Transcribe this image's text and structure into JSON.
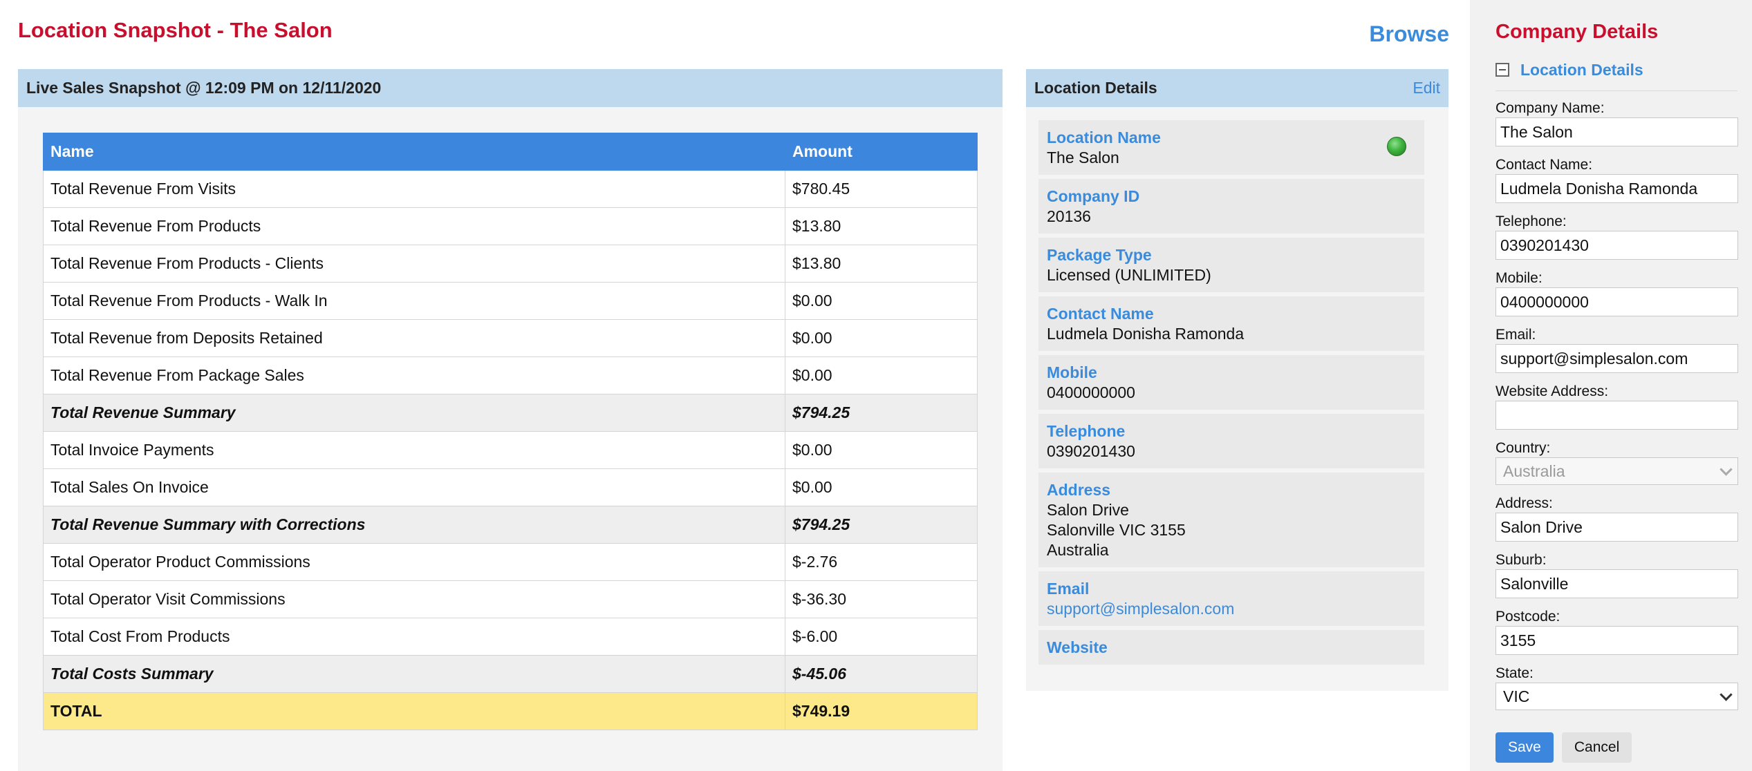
{
  "header": {
    "title": "Location Snapshot - The Salon",
    "browse_label": "Browse"
  },
  "snapshot": {
    "header": "Live Sales Snapshot @ 12:09 PM on 12/11/2020",
    "columns": [
      "Name",
      "Amount"
    ],
    "rows": [
      {
        "name": "Total Revenue From Visits",
        "amount": "$780.45",
        "style": "normal"
      },
      {
        "name": "Total Revenue From Products",
        "amount": "$13.80",
        "style": "normal"
      },
      {
        "name": "Total Revenue From Products - Clients",
        "amount": "$13.80",
        "style": "normal"
      },
      {
        "name": "Total Revenue From Products - Walk In",
        "amount": "$0.00",
        "style": "normal"
      },
      {
        "name": "Total Revenue from Deposits Retained",
        "amount": "$0.00",
        "style": "normal"
      },
      {
        "name": "Total Revenue From Package Sales",
        "amount": "$0.00",
        "style": "normal"
      },
      {
        "name": "Total Revenue Summary",
        "amount": "$794.25",
        "style": "summary"
      },
      {
        "name": "Total Invoice Payments",
        "amount": "$0.00",
        "style": "normal"
      },
      {
        "name": "Total Sales On Invoice",
        "amount": "$0.00",
        "style": "normal"
      },
      {
        "name": "Total Revenue Summary with Corrections",
        "amount": "$794.25",
        "style": "summary"
      },
      {
        "name": "Total Operator Product Commissions",
        "amount": "$-2.76",
        "style": "normal"
      },
      {
        "name": "Total Operator Visit Commissions",
        "amount": "$-36.30",
        "style": "normal"
      },
      {
        "name": "Total Cost From Products",
        "amount": "$-6.00",
        "style": "normal"
      },
      {
        "name": "Total Costs Summary",
        "amount": "$-45.06",
        "style": "summary"
      },
      {
        "name": "TOTAL",
        "amount": "$749.19",
        "style": "total"
      }
    ]
  },
  "location": {
    "header": "Location Details",
    "edit_label": "Edit",
    "items": [
      {
        "label": "Location Name",
        "lines": [
          "The Salon"
        ],
        "status_icon": "green-status-icon"
      },
      {
        "label": "Company ID",
        "lines": [
          "20136"
        ]
      },
      {
        "label": "Package Type",
        "lines": [
          "Licensed (UNLIMITED)"
        ]
      },
      {
        "label": "Contact Name",
        "lines": [
          "Ludmela Donisha Ramonda"
        ]
      },
      {
        "label": "Mobile",
        "lines": [
          "0400000000"
        ]
      },
      {
        "label": "Telephone",
        "lines": [
          "0390201430"
        ]
      },
      {
        "label": "Address",
        "lines": [
          "Salon Drive",
          "Salonville VIC 3155",
          "Australia"
        ]
      },
      {
        "label": "Email",
        "lines": [
          "support@simplesalon.com"
        ],
        "link": true
      },
      {
        "label": "Website",
        "lines": []
      }
    ]
  },
  "sidebar": {
    "title": "Company Details",
    "section_label": "Location Details",
    "fields": [
      {
        "label": "Company Name:",
        "value": "The Salon",
        "type": "text"
      },
      {
        "label": "Contact Name:",
        "value": "Ludmela Donisha Ramonda",
        "type": "text"
      },
      {
        "label": "Telephone:",
        "value": "0390201430",
        "type": "text"
      },
      {
        "label": "Mobile:",
        "value": "0400000000",
        "type": "text"
      },
      {
        "label": "Email:",
        "value": "support@simplesalon.com",
        "type": "text"
      },
      {
        "label": "Website Address:",
        "value": "",
        "type": "text"
      },
      {
        "label": "Country:",
        "value": "Australia",
        "type": "select-disabled"
      },
      {
        "label": "Address:",
        "value": "Salon Drive",
        "type": "text"
      },
      {
        "label": "Suburb:",
        "value": "Salonville",
        "type": "text"
      },
      {
        "label": "Postcode:",
        "value": "3155",
        "type": "text"
      },
      {
        "label": "State:",
        "value": "VIC",
        "type": "select"
      }
    ],
    "save_label": "Save",
    "cancel_label": "Cancel"
  },
  "colors": {
    "title_red": "#c8102e",
    "accent_blue": "#3a8bdc",
    "table_header": "#3d86dd",
    "panel_header": "#bed8ee",
    "total_row": "#fde98a"
  }
}
